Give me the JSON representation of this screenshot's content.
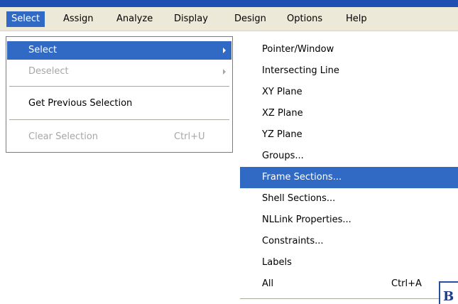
{
  "menubar": {
    "items": [
      "Select",
      "Assign",
      "Analyze",
      "Display",
      "Design",
      "Options",
      "Help"
    ]
  },
  "select_menu": {
    "items": [
      {
        "label": "Select",
        "shortcut": "",
        "submenu": true,
        "state": "highlighted"
      },
      {
        "label": "Deselect",
        "shortcut": "",
        "submenu": true,
        "state": "disabled"
      },
      {
        "label": "Get Previous Selection",
        "shortcut": "",
        "submenu": false,
        "state": "enabled"
      },
      {
        "label": "Clear Selection",
        "shortcut": "Ctrl+U",
        "submenu": false,
        "state": "disabled"
      }
    ]
  },
  "submenu": {
    "items": [
      {
        "label": "Pointer/Window",
        "shortcut": ""
      },
      {
        "label": "Intersecting Line",
        "shortcut": ""
      },
      {
        "label": "XY Plane",
        "shortcut": ""
      },
      {
        "label": "XZ Plane",
        "shortcut": ""
      },
      {
        "label": "YZ Plane",
        "shortcut": ""
      },
      {
        "label": "Groups...",
        "shortcut": ""
      },
      {
        "label": "Frame Sections...",
        "shortcut": "",
        "state": "highlighted"
      },
      {
        "label": "Shell Sections...",
        "shortcut": ""
      },
      {
        "label": "NLLink Properties...",
        "shortcut": ""
      },
      {
        "label": "Constraints...",
        "shortcut": ""
      },
      {
        "label": "Labels",
        "shortcut": ""
      },
      {
        "label": "All",
        "shortcut": "Ctrl+A"
      }
    ]
  },
  "corner_label": "B",
  "colors": {
    "highlight": "#316ac5",
    "menubar_bg": "#ece9d8",
    "disabled_text": "#a7a6aa",
    "title_strip": "#1f4fb0"
  }
}
